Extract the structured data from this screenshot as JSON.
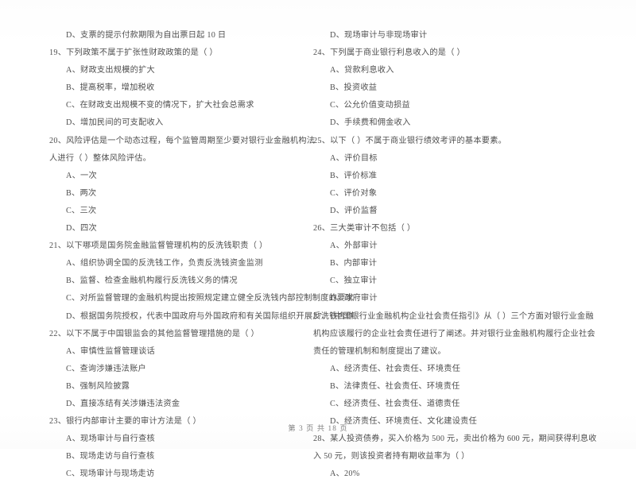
{
  "document": {
    "type": "exam-paper-scan",
    "footer": "第 3 页 共 18 页",
    "ink_color": "#4f4f4f",
    "paper_color": "#ffffff"
  },
  "left_column": {
    "orphan_option": "D、支票的提示付款期限为自出票日起 10 日",
    "questions": [
      {
        "number": "19",
        "stem": "19、下列政策不属于扩张性财政政策的是（        ）",
        "options": [
          "A、财政支出规模的扩大",
          "B、提高税率，增加税收",
          "C、在财政支出规模不变的情况下，扩大社会总需求",
          "D、增加民间的可支配收入"
        ]
      },
      {
        "number": "20",
        "stem": "20、风险评估是一个动态过程，每个监管周期至少要对银行业金融机构法人进行（        ）整体风险评估。",
        "options": [
          "A、一次",
          "B、两次",
          "C、三次",
          "D、四次"
        ]
      },
      {
        "number": "21",
        "stem": "21、以下哪项是国务院金融监督管理机构的反洗钱职责（        ）",
        "options": [
          "A、组织协调全国的反洗钱工作，负责反洗钱资金监测",
          "B、监督、检查金融机构履行反洗钱义务的情况",
          "C、对所监督管理的金融机构提出按照规定建立健全反洗钱内部控制制度的要求",
          "D、根据国务院授权，代表中国政府与外国政府和有关国际组织开展反洗钱合作"
        ]
      },
      {
        "number": "22",
        "stem": "22、以下不属于中国银监会的其他监督管理措施的是（        ）",
        "options": [
          "A、审慎性监督管理谈话",
          "C、查询涉嫌违法账户",
          "B、强制风险披露",
          "D、直接冻结有关涉嫌违法资金"
        ]
      },
      {
        "number": "23",
        "stem": "23、银行内部审计主要的审计方法是（        ）",
        "options": [
          "A、现场审计与自行查核",
          "B、现场走访与自行查核",
          "C、现场审计与现场走访"
        ]
      }
    ]
  },
  "right_column": {
    "orphan_option": "D、现场审计与非现场审计",
    "questions": [
      {
        "number": "24",
        "stem": "24、下列属于商业银行利息收入的是（        ）",
        "options": [
          "A、贷款利息收入",
          "B、投资收益",
          "C、公允价值变动损益",
          "D、手续费和佣金收入"
        ]
      },
      {
        "number": "25",
        "stem": "25、以下（        ）不属于商业银行绩效考评的基本要素。",
        "options": [
          "A、评价目标",
          "B、评价标准",
          "C、评价对象",
          "D、评价监督"
        ]
      },
      {
        "number": "26",
        "stem": "26、三大类审计不包括（        ）",
        "options": [
          "A、外部审计",
          "B、内部审计",
          "C、独立审计",
          "D、政府审计"
        ]
      },
      {
        "number": "27",
        "stem": "27、《中国银行业金融机构企业社会责任指引》从（        ）三个方面对银行业金融机构应该履行的企业社会责任进行了阐述。并对银行业金融机构履行企业社会责任的管理机制和制度提出了建议。",
        "options": [
          "A、经济责任、社会责任、环境责任",
          "B、法律责任、社会责任、环境责任",
          "C、经济责任、社会责任、道德责任",
          "D、经济责任、环境责任、文化建设责任"
        ]
      },
      {
        "number": "28",
        "stem": "28、某人投资债券，买入价格为 500 元，卖出价格为 600 元，期间获得利息收入 50 元，则该投资者持有期收益率为（        ）",
        "options": [
          "A、20%"
        ]
      }
    ]
  }
}
